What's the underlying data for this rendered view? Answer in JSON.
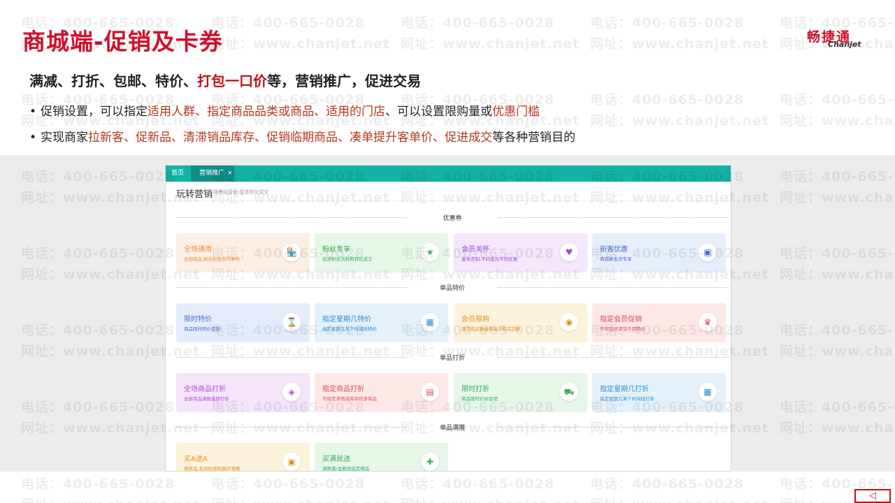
{
  "slide": {
    "title": "商城端-促销及卡券",
    "logo_cn": "畅捷通",
    "logo_en": "Chanjet",
    "headline_before": "满减、打折、包邮、特价、",
    "headline_highlight": "打包一口价",
    "headline_after": "等，营销推广，促进交易",
    "bullets": [
      {
        "dot": "•",
        "plain1": "促销设置，可以指定",
        "hl1": "适用人群、指定商品品类或商品、适用的门店",
        "plain2": "、可以设置限购量或",
        "hl2": "优惠门槛",
        "plain3": ""
      },
      {
        "dot": "•",
        "plain1": "实现商家",
        "hl1": "拉新客、促新品、清滞销品库存、促销临期商品、凑单提升客单价、促进成交",
        "plain2": "等各种营销目的",
        "hl2": "",
        "plain3": ""
      }
    ],
    "watermark_phone": "电话：400-665-0028",
    "watermark_url": "网址：www.chanjet.net",
    "nav_button": "◁"
  },
  "screenshot": {
    "tabs": {
      "home": "首页",
      "active": "营销推广",
      "close": "×"
    },
    "page_title": "玩转营销",
    "page_subtitle": "场景化营销,促进转化成交",
    "sections": [
      {
        "label": "优惠券",
        "cards": [
          {
            "title": "全场通用",
            "desc": "全部商品,粉丝和会员均参与",
            "icon": "store-icon",
            "glyph": "🏪",
            "bg": "#fdefe4",
            "fg": "#f08a3c"
          },
          {
            "title": "粉丝专享",
            "desc": "促进粉丝活跃和转化成交",
            "icon": "star-icon",
            "glyph": "★",
            "bg": "#e6f7ea",
            "fg": "#3aab55"
          },
          {
            "title": "会员关怀",
            "desc": "量身定制,不同会员不同优惠",
            "icon": "member-icon",
            "glyph": "♥",
            "bg": "#f4e6fb",
            "fg": "#9b4fd0"
          },
          {
            "title": "新客优惠",
            "desc": "商城新会员专享",
            "icon": "ticket-icon",
            "glyph": "▣",
            "bg": "#e6edfb",
            "fg": "#4a6fd8"
          }
        ]
      },
      {
        "label": "单品特价",
        "cards": [
          {
            "title": "限时特价",
            "desc": "商品限时特价促销",
            "icon": "timer-icon",
            "glyph": "⌛",
            "bg": "#e4ecfb",
            "fg": "#4a6fd8"
          },
          {
            "title": "指定星期几特价",
            "desc": "指定星期几某个时间段特价",
            "icon": "calendar-icon",
            "glyph": "▦",
            "bg": "#e3f1fb",
            "fg": "#2b8fd6"
          },
          {
            "title": "会员限购",
            "desc": "限定购买数量和每日购买次数",
            "icon": "user-limit-icon",
            "glyph": "◉",
            "bg": "#fdf3dd",
            "fg": "#e0901c"
          },
          {
            "title": "指定会员促销",
            "desc": "不同会员享受不同特价",
            "icon": "crown-icon",
            "glyph": "♛",
            "bg": "#fde8e8",
            "fg": "#e0474f"
          }
        ]
      },
      {
        "label": "单品打折",
        "cards": [
          {
            "title": "全场商品打折",
            "desc": "全部商品满数量即打折",
            "icon": "tag-icon",
            "glyph": "◈",
            "bg": "#f4e5fa",
            "fg": "#b14fd0"
          },
          {
            "title": "指定商品打折",
            "desc": "可指定滞销或库存较多商品",
            "icon": "bag-icon",
            "glyph": "▤",
            "bg": "#fde8e8",
            "fg": "#e0474f"
          },
          {
            "title": "限时打折",
            "desc": "商品限时打折促销",
            "icon": "cart-icon",
            "glyph": "⛟",
            "bg": "#e6f7ea",
            "fg": "#3aab55"
          },
          {
            "title": "指定星期几打折",
            "desc": "指定星期几某个时间段打折",
            "icon": "calendar-icon",
            "glyph": "▦",
            "bg": "#e4f1fb",
            "fg": "#2b8fd6"
          }
        ]
      },
      {
        "label": "单品满赠",
        "cards": [
          {
            "title": "买A送A",
            "desc": "赠原品,支持阶梯和循环满赠",
            "icon": "gift-box-icon",
            "glyph": "▣",
            "bg": "#fdf3dd",
            "fg": "#e0901c"
          },
          {
            "title": "买满就送",
            "desc": "满数量/金额送指定赠品",
            "icon": "gift-icon",
            "glyph": "✚",
            "bg": "#e6f7ea",
            "fg": "#3aab55"
          }
        ]
      }
    ]
  }
}
